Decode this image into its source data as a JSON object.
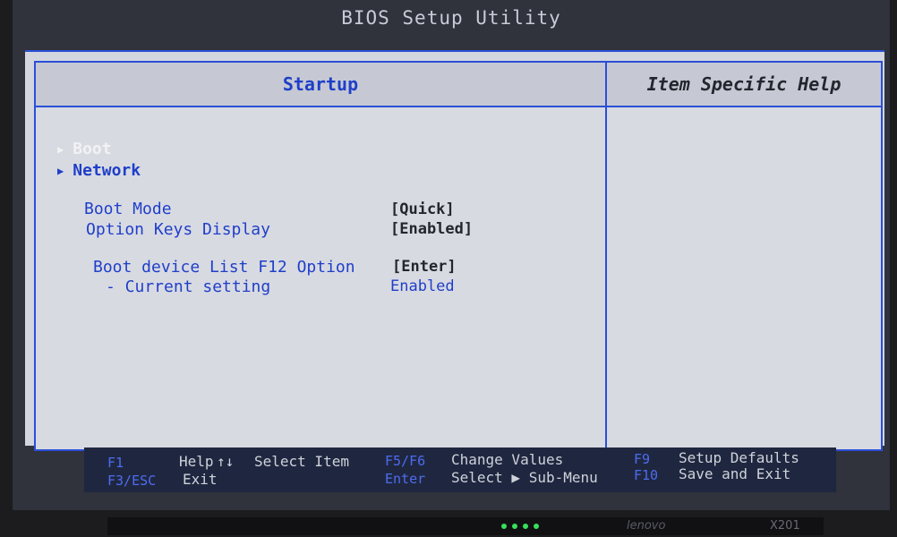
{
  "window_title": "BIOS Setup Utility",
  "header": {
    "main_title": "Startup",
    "help_title": "Item Specific Help"
  },
  "submenus": [
    {
      "label": "Boot",
      "selected": true
    },
    {
      "label": "Network",
      "selected": false
    }
  ],
  "settings": [
    {
      "label": "Boot Mode",
      "value": "[Quick]"
    },
    {
      "label": "Option Keys Display",
      "value": "[Enabled]"
    },
    {
      "label": "Boot device List F12 Option",
      "value": "[Enter]"
    },
    {
      "label": "- Current setting",
      "value": "Enabled"
    }
  ],
  "footer": {
    "f1_key": "F1",
    "f1_text": "Help",
    "arrows_glyph": "↑↓",
    "arrows_text": "Select Item",
    "esc_key": "F3/ESC",
    "esc_text": "Exit",
    "f5f6_key": "F5/F6",
    "f5f6_text": "Change Values",
    "enter_key": "Enter",
    "enter_text": "Select ▶ Sub-Menu",
    "f9_key": "F9",
    "f9_text": "Setup Defaults",
    "f10_key": "F10",
    "f10_text": "Save and Exit"
  },
  "hardware": {
    "brand": "lenovo",
    "model": "X201"
  },
  "colors": {
    "accent_blue": "#2a4fd6",
    "panel_bg": "#d8dae2",
    "selected_text": "#f2f2f4"
  }
}
